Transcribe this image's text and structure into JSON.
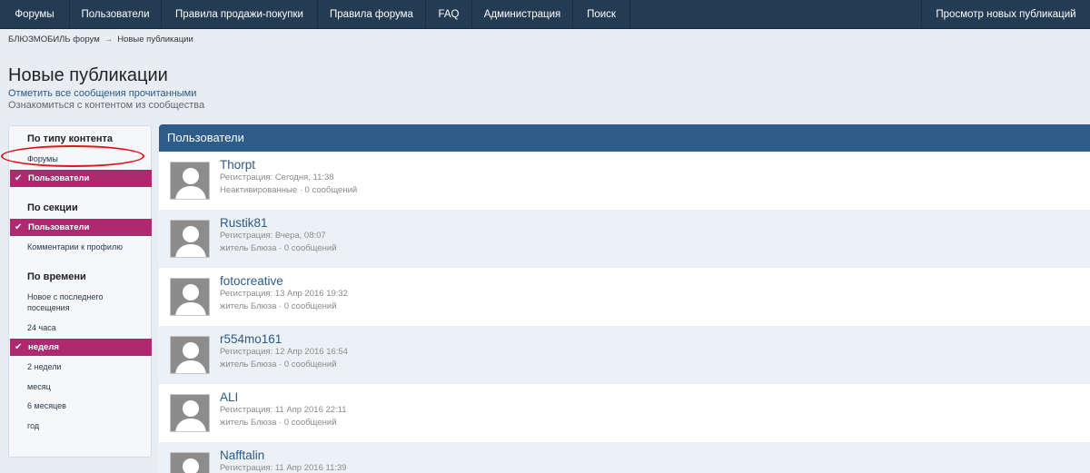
{
  "nav": {
    "items": [
      "Форумы",
      "Пользователи",
      "Правила продажи-покупки",
      "Правила форума",
      "FAQ",
      "Администрация",
      "Поиск"
    ],
    "right": "Просмотр новых публикаций"
  },
  "breadcrumb": {
    "home": "БЛЮЗМОБИЛЬ форум",
    "separator": "→",
    "current": "Новые публикации"
  },
  "header": {
    "title": "Новые публикации",
    "mark_read": "Отметить все сообщения прочитанными",
    "explore": "Ознакомиться с контентом из сообщества"
  },
  "sidebar": {
    "type_heading": "По типу контента",
    "type_forums": "Форумы",
    "type_users": "Пользователи",
    "section_heading": "По секции",
    "section_users": "Пользователи",
    "section_comments": "Комментарии к профилю",
    "time_heading": "По времени",
    "time_since_last": "Новое с последнего посещения",
    "time_24h": "24 часа",
    "time_week": "неделя",
    "time_2weeks": "2 недели",
    "time_month": "месяц",
    "time_6months": "6 месяцев",
    "time_year": "год"
  },
  "panel": {
    "title": "Пользователи"
  },
  "members": [
    {
      "name": "Thorpt",
      "registered": "Регистрация: Сегодня, 11:38",
      "info": "Неактивированные · 0 сообщений"
    },
    {
      "name": "Rustik81",
      "registered": "Регистрация: Вчера, 08:07",
      "info": "житель Блюза · 0 сообщений"
    },
    {
      "name": "fotocreative",
      "registered": "Регистрация: 13 Апр 2016 19:32",
      "info": "житель Блюза · 0 сообщений"
    },
    {
      "name": "r554mo161",
      "registered": "Регистрация: 12 Апр 2016 16:54",
      "info": "житель Блюза · 0 сообщений"
    },
    {
      "name": "ALI",
      "registered": "Регистрация: 11 Апр 2016 22:11",
      "info": "житель Блюза · 0 сообщений"
    },
    {
      "name": "Nafftalin",
      "registered": "Регистрация: 11 Апр 2016 11:39",
      "info": ""
    }
  ],
  "colors": {
    "nav": "#233b53",
    "accent_active": "#b0286f",
    "panel_head": "#2f5d8a",
    "link": "#2d5a86",
    "annotation": "#e0151b"
  }
}
